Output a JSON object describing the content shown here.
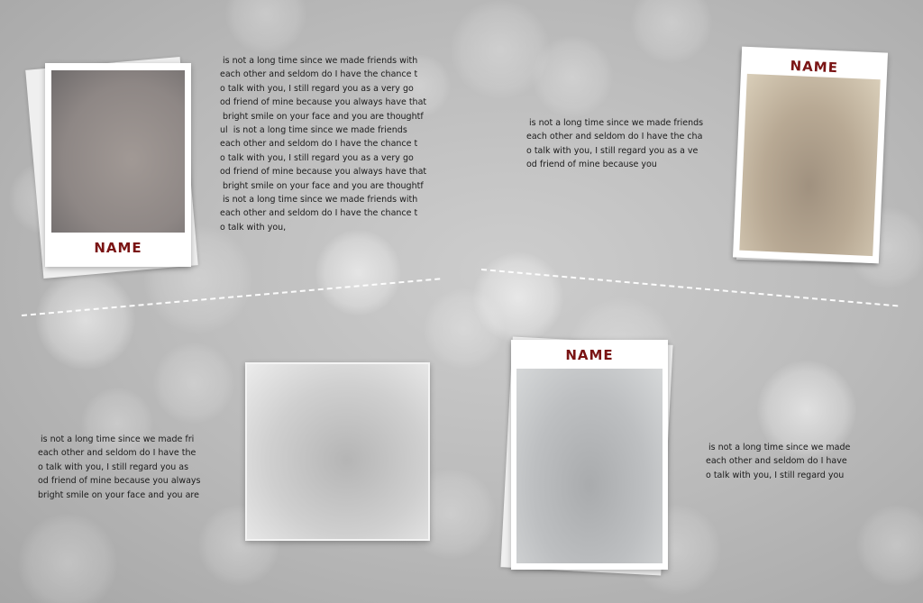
{
  "colors": {
    "name_label": "#7a1414",
    "text": "#1a1a1a",
    "dashes": "#ffffff"
  },
  "cards": {
    "top_left": {
      "name": "NAME"
    },
    "top_right": {
      "name": "NAME"
    },
    "bottom_right": {
      "name": "NAME"
    }
  },
  "text_blocks": {
    "top_left": [
      " is not a long time since we made friends with",
      "each other and seldom do I have the chance t",
      "o talk with you, I still regard you as a very go",
      "od friend of mine because you always have that",
      " bright smile on your face and you are thoughtf",
      "ul  is not a long time since we made friends",
      "each other and seldom do I have the chance t",
      "o talk with you, I still regard you as a very go",
      "od friend of mine because you always have that",
      " bright smile on your face and you are thoughtf",
      " is not a long time since we made friends with",
      "each other and seldom do I have the chance t",
      "o talk with you,"
    ],
    "top_middle": [
      " is not a long time since we made friends",
      "each other and seldom do I have the cha",
      "o talk with you, I still regard you as a ve",
      "od friend of mine because you"
    ],
    "bottom_left": [
      " is not a long time since we made fri",
      "each other and seldom do I have the",
      "o talk with you, I still regard you as",
      "od friend of mine because you always",
      "bright smile on your face and you are"
    ],
    "bottom_right": [
      " is not a long time since we made",
      "each other and seldom do I have",
      "o talk with you, I still regard you"
    ]
  }
}
